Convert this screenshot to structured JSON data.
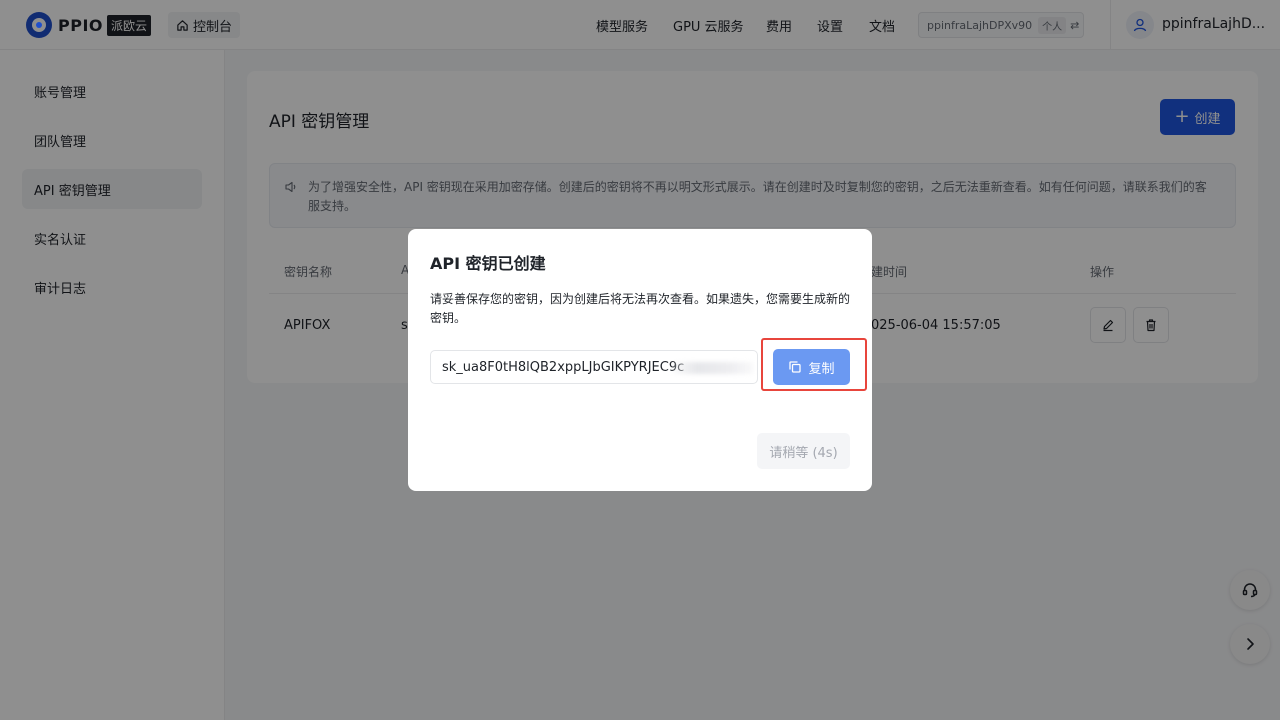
{
  "header": {
    "logo_text": "PPIO",
    "logo_cn": "派欧云",
    "console_label": "控制台",
    "nav": [
      "模型服务",
      "GPU 云服务",
      "费用",
      "设置",
      "文档"
    ],
    "account_id": "ppinfraLajhDPXv90",
    "account_tag": "个人",
    "swap_icon": "⇄",
    "user_name": "ppinfraLajhD..."
  },
  "sidebar": {
    "items": [
      {
        "label": "账号管理"
      },
      {
        "label": "团队管理"
      },
      {
        "label": "API 密钥管理"
      },
      {
        "label": "实名认证"
      },
      {
        "label": "审计日志"
      }
    ],
    "active_index": 2
  },
  "main": {
    "title": "API 密钥管理",
    "create_label": "创建",
    "notice": "为了增强安全性，API 密钥现在采用加密存储。创建后的密钥将不再以明文形式展示。请在创建时及时复制您的密钥，之后无法重新查看。如有任何问题，请联系我们的客服支持。",
    "table": {
      "headers": [
        "密钥名称",
        "A",
        "建时间",
        "操作"
      ],
      "rows": [
        {
          "name": "APIFOX",
          "key_prefix": "s",
          "created": "025-06-04 15:57:05"
        }
      ]
    }
  },
  "modal": {
    "title": "API 密钥已创建",
    "description": "请妥善保存您的密钥，因为创建后将无法再次查看。如果遗失，您需要生成新的密钥。",
    "key_value": "sk_ua8F0tH8lQB2xppLJbGIKPYRJEC9c",
    "copy_label": "复制",
    "wait_label": "请稍等 (4s)"
  },
  "colors": {
    "primary": "#1f56e0",
    "copy_button": "#6b99f2",
    "highlight": "#e8453c"
  },
  "icons": [
    "home-icon",
    "plus-icon",
    "speaker-icon",
    "edit-icon",
    "trash-icon",
    "copy-icon",
    "user-icon",
    "headset-icon",
    "chevron-right-icon"
  ]
}
